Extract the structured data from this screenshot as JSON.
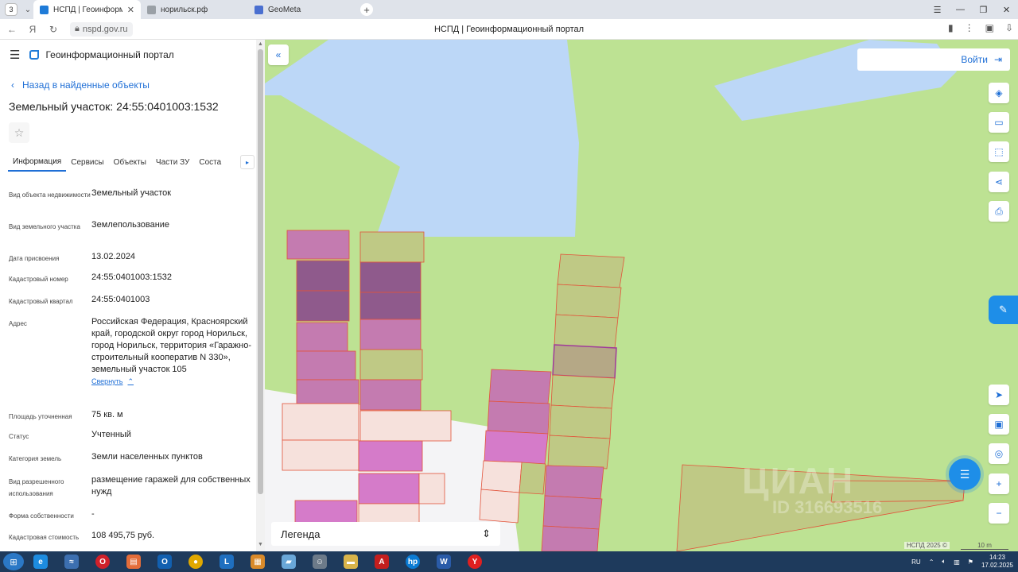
{
  "browser": {
    "tab_count": "3",
    "tabs": [
      {
        "label": "НСПД | Геоинформацио",
        "favicon_color": "#1f7bd8"
      },
      {
        "label": "норильск.рф",
        "favicon_color": "#9aa0a6"
      },
      {
        "label": "GeoMeta",
        "favicon_color": "#4a6fd0"
      }
    ],
    "url": "nspd.gov.ru",
    "page_title": "НСПД | Геоинформационный портал"
  },
  "sidebar": {
    "app_title": "Геоинформационный портал",
    "back_label": "Назад в найденные объекты",
    "object_title": "Земельный участок: 24:55:0401003:1532",
    "tabs": [
      "Информация",
      "Сервисы",
      "Объекты",
      "Части ЗУ",
      "Соста"
    ],
    "properties": [
      {
        "key": "Вид объекта недвижимости",
        "value": "Земельный участок"
      },
      {
        "key": "Вид земельного участка",
        "value": "Землепользование"
      },
      {
        "key": "Дата присвоения",
        "value": "13.02.2024"
      },
      {
        "key": "Кадастровый номер",
        "value": "24:55:0401003:1532"
      },
      {
        "key": "Кадастровый квартал",
        "value": "24:55:0401003"
      },
      {
        "key": "Адрес",
        "value": "Российская Федерация, Красноярский край, городской округ город Норильск, город Норильск, территория «Гаражно-строительный кооператив N 330», земельный участок 105"
      },
      {
        "key": "Площадь уточненная",
        "value": "75 кв. м"
      },
      {
        "key": "Статус",
        "value": "Учтенный"
      },
      {
        "key": "Категория земель",
        "value": "Земли населенных пунктов"
      },
      {
        "key": "Вид разрешенного использования",
        "value": "размещение гаражей для собственных нужд"
      },
      {
        "key": "Форма собственности",
        "value": "-"
      },
      {
        "key": "Кадастровая стоимость",
        "value": "108 495,75 руб."
      }
    ],
    "collapse_label": "Свернуть"
  },
  "map": {
    "login_label": "Войти",
    "legend_label": "Легенда",
    "attribution": "НСПД 2025 ©",
    "scale_label": "10 m",
    "watermark_brand": "ЦИАН",
    "watermark_id": "ID 316693516",
    "colors": {
      "land": "#bde293",
      "water": "#bcd7f7",
      "parcel_outline": "#e2533a",
      "selected": "#c47bb0",
      "dark_selected": "#8f5a8c",
      "pale": "#f6e1dc"
    }
  },
  "taskbar": {
    "language": "RU",
    "time": "14:23",
    "date": "17.02.2025"
  }
}
